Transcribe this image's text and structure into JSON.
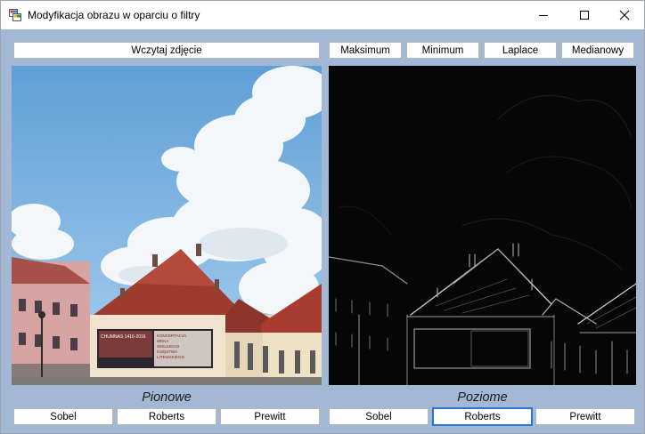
{
  "window": {
    "title": "Modyfikacja obrazu w oparciu o filtry",
    "icon": "app-icon"
  },
  "toolbar": {
    "load_label": "Wczytaj zdjęcie",
    "filters": [
      "Maksimum",
      "Minimum",
      "Laplace",
      "Medianowy"
    ]
  },
  "left_panel": {
    "caption": "Pionowe",
    "buttons": [
      "Sobel",
      "Roberts",
      "Prewitt"
    ],
    "billboard_lines": [
      "CHUMNAS 1416-2016",
      "KONCERTACJA",
      "WEKA",
      "WIELKIEGO",
      "KSIĘSTWA",
      "LITEWSKIEGO"
    ]
  },
  "right_panel": {
    "caption": "Poziome",
    "buttons": [
      "Sobel",
      "Roberts",
      "Prewitt"
    ],
    "focused_button": "Roberts"
  },
  "colors": {
    "client_bg": "#a3b8d4",
    "focus_border": "#2b73d1",
    "sky": "#8fbde3",
    "edge_bg": "#050505"
  }
}
